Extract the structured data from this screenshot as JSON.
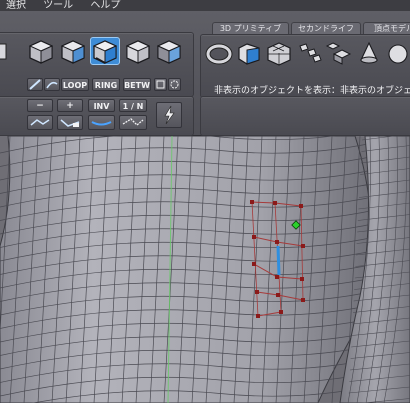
{
  "menu": {
    "items": [
      "選択",
      "ツール",
      "ヘルプ"
    ]
  },
  "tabs": [
    {
      "label": "3D プリミティブ"
    },
    {
      "label": "セカンドライフ"
    },
    {
      "label": "頂点モデル"
    }
  ],
  "selection_modes": {
    "loop_label": "LOOP",
    "ring_label": "RING",
    "between_label": "BETW"
  },
  "edit_buttons": {
    "minus_label": "−",
    "plus_label": "+",
    "invert_label": "INV",
    "one_of_n_label": "1 / N"
  },
  "status": {
    "hidden_objects_text": "非表示のオブジェクトを表示：非表示のオブジェクト"
  },
  "colors": {
    "active_button": "#3e8cd6",
    "selected_edge": "#2f8fe0",
    "selected_vertex": "#2bd12b",
    "loop_vertex": "#8b1a1a",
    "loop_edge": "#a63a3a",
    "axis_line": "#66cc66"
  }
}
